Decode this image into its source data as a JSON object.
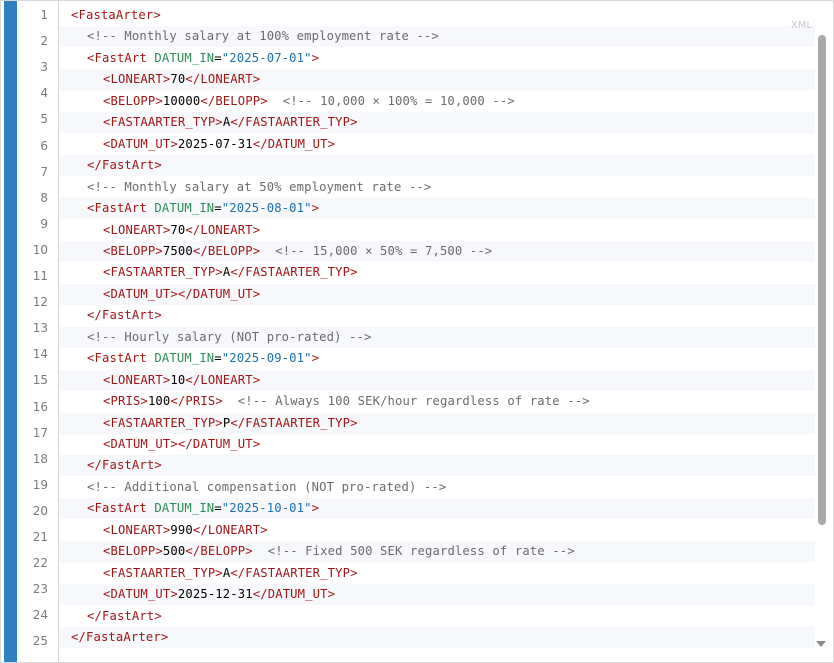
{
  "editor": {
    "language_badge": "XML",
    "line_numbers": [
      "1",
      "2",
      "3",
      "4",
      "5",
      "6",
      "7",
      "8",
      "9",
      "10",
      "11",
      "12",
      "13",
      "14",
      "15",
      "16",
      "17",
      "18",
      "19",
      "20",
      "21",
      "22",
      "23",
      "24",
      "25"
    ]
  },
  "code_lines": [
    {
      "indent": 0,
      "kind": "tag",
      "parts": [
        [
          "tag",
          "<FastaArter>"
        ]
      ]
    },
    {
      "indent": 1,
      "kind": "comment",
      "parts": [
        [
          "cm",
          "<!-- Monthly salary at 100% employment rate -->"
        ]
      ]
    },
    {
      "indent": 1,
      "kind": "open",
      "parts": [
        [
          "tag",
          "<FastArt "
        ],
        [
          "attr",
          "DATUM_IN"
        ],
        [
          "eq",
          "="
        ],
        [
          "val",
          "\"2025-07-01\""
        ],
        [
          "tag",
          ">"
        ]
      ]
    },
    {
      "indent": 2,
      "kind": "field",
      "parts": [
        [
          "tag",
          "<LONEART>"
        ],
        [
          "txt",
          "70"
        ],
        [
          "tag",
          "</LONEART>"
        ]
      ]
    },
    {
      "indent": 2,
      "kind": "field",
      "parts": [
        [
          "tag",
          "<BELOPP>"
        ],
        [
          "txt",
          "10000"
        ],
        [
          "tag",
          "</BELOPP>"
        ],
        [
          "cm",
          "  <!-- 10,000 × 100% = 10,000 -->"
        ]
      ]
    },
    {
      "indent": 2,
      "kind": "field",
      "parts": [
        [
          "tag",
          "<FASTAARTER_TYP>"
        ],
        [
          "txt",
          "A"
        ],
        [
          "tag",
          "</FASTAARTER_TYP>"
        ]
      ]
    },
    {
      "indent": 2,
      "kind": "field",
      "parts": [
        [
          "tag",
          "<DATUM_UT>"
        ],
        [
          "txt",
          "2025-07-31"
        ],
        [
          "tag",
          "</DATUM_UT>"
        ]
      ]
    },
    {
      "indent": 1,
      "kind": "close",
      "parts": [
        [
          "tag",
          "</FastArt>"
        ]
      ]
    },
    {
      "indent": 1,
      "kind": "comment",
      "parts": [
        [
          "cm",
          "<!-- Monthly salary at 50% employment rate -->"
        ]
      ]
    },
    {
      "indent": 1,
      "kind": "open",
      "parts": [
        [
          "tag",
          "<FastArt "
        ],
        [
          "attr",
          "DATUM_IN"
        ],
        [
          "eq",
          "="
        ],
        [
          "val",
          "\"2025-08-01\""
        ],
        [
          "tag",
          ">"
        ]
      ]
    },
    {
      "indent": 2,
      "kind": "field",
      "parts": [
        [
          "tag",
          "<LONEART>"
        ],
        [
          "txt",
          "70"
        ],
        [
          "tag",
          "</LONEART>"
        ]
      ]
    },
    {
      "indent": 2,
      "kind": "field",
      "parts": [
        [
          "tag",
          "<BELOPP>"
        ],
        [
          "txt",
          "7500"
        ],
        [
          "tag",
          "</BELOPP>"
        ],
        [
          "cm",
          "  <!-- 15,000 × 50% = 7,500 -->"
        ]
      ]
    },
    {
      "indent": 2,
      "kind": "field",
      "parts": [
        [
          "tag",
          "<FASTAARTER_TYP>"
        ],
        [
          "txt",
          "A"
        ],
        [
          "tag",
          "</FASTAARTER_TYP>"
        ]
      ]
    },
    {
      "indent": 2,
      "kind": "field",
      "parts": [
        [
          "tag",
          "<DATUM_UT></DATUM_UT>"
        ]
      ]
    },
    {
      "indent": 1,
      "kind": "close",
      "parts": [
        [
          "tag",
          "</FastArt>"
        ]
      ]
    },
    {
      "indent": 1,
      "kind": "comment",
      "parts": [
        [
          "cm",
          "<!-- Hourly salary (NOT pro-rated) -->"
        ]
      ]
    },
    {
      "indent": 1,
      "kind": "open",
      "parts": [
        [
          "tag",
          "<FastArt "
        ],
        [
          "attr",
          "DATUM_IN"
        ],
        [
          "eq",
          "="
        ],
        [
          "val",
          "\"2025-09-01\""
        ],
        [
          "tag",
          ">"
        ]
      ]
    },
    {
      "indent": 2,
      "kind": "field",
      "parts": [
        [
          "tag",
          "<LONEART>"
        ],
        [
          "txt",
          "10"
        ],
        [
          "tag",
          "</LONEART>"
        ]
      ]
    },
    {
      "indent": 2,
      "kind": "field",
      "parts": [
        [
          "tag",
          "<PRIS>"
        ],
        [
          "txt",
          "100"
        ],
        [
          "tag",
          "</PRIS>"
        ],
        [
          "cm",
          "  <!-- Always 100 SEK/hour regardless of rate -->"
        ]
      ]
    },
    {
      "indent": 2,
      "kind": "field",
      "parts": [
        [
          "tag",
          "<FASTAARTER_TYP>"
        ],
        [
          "txt",
          "P"
        ],
        [
          "tag",
          "</FASTAARTER_TYP>"
        ]
      ]
    },
    {
      "indent": 2,
      "kind": "field",
      "parts": [
        [
          "tag",
          "<DATUM_UT></DATUM_UT>"
        ]
      ]
    },
    {
      "indent": 1,
      "kind": "close",
      "parts": [
        [
          "tag",
          "</FastArt>"
        ]
      ]
    },
    {
      "indent": 1,
      "kind": "comment",
      "parts": [
        [
          "cm",
          "<!-- Additional compensation (NOT pro-rated) -->"
        ]
      ]
    },
    {
      "indent": 1,
      "kind": "open",
      "parts": [
        [
          "tag",
          "<FastArt "
        ],
        [
          "attr",
          "DATUM_IN"
        ],
        [
          "eq",
          "="
        ],
        [
          "val",
          "\"2025-10-01\""
        ],
        [
          "tag",
          ">"
        ]
      ]
    },
    {
      "indent": 2,
      "kind": "field",
      "parts": [
        [
          "tag",
          "<LONEART>"
        ],
        [
          "txt",
          "990"
        ],
        [
          "tag",
          "</LONEART>"
        ]
      ]
    },
    {
      "indent": 2,
      "kind": "field",
      "parts": [
        [
          "tag",
          "<BELOPP>"
        ],
        [
          "txt",
          "500"
        ],
        [
          "tag",
          "</BELOPP>"
        ],
        [
          "cm",
          "  <!-- Fixed 500 SEK regardless of rate -->"
        ]
      ]
    },
    {
      "indent": 2,
      "kind": "field",
      "parts": [
        [
          "tag",
          "<FASTAARTER_TYP>"
        ],
        [
          "txt",
          "A"
        ],
        [
          "tag",
          "</FASTAARTER_TYP>"
        ]
      ]
    },
    {
      "indent": 2,
      "kind": "field",
      "parts": [
        [
          "tag",
          "<DATUM_UT>"
        ],
        [
          "txt",
          "2025-12-31"
        ],
        [
          "tag",
          "</DATUM_UT>"
        ]
      ]
    },
    {
      "indent": 1,
      "kind": "close",
      "parts": [
        [
          "tag",
          "</FastArt>"
        ]
      ]
    },
    {
      "indent": 0,
      "kind": "close",
      "parts": [
        [
          "tag",
          "</FastaArter>"
        ]
      ]
    }
  ],
  "colors": {
    "accent_bar": "#2f7fc1",
    "tag": "#a31515",
    "attribute": "#2e8b57",
    "value": "#1e6fb0",
    "comment": "#6b6b6b",
    "stripe": "#f6f8fb"
  }
}
